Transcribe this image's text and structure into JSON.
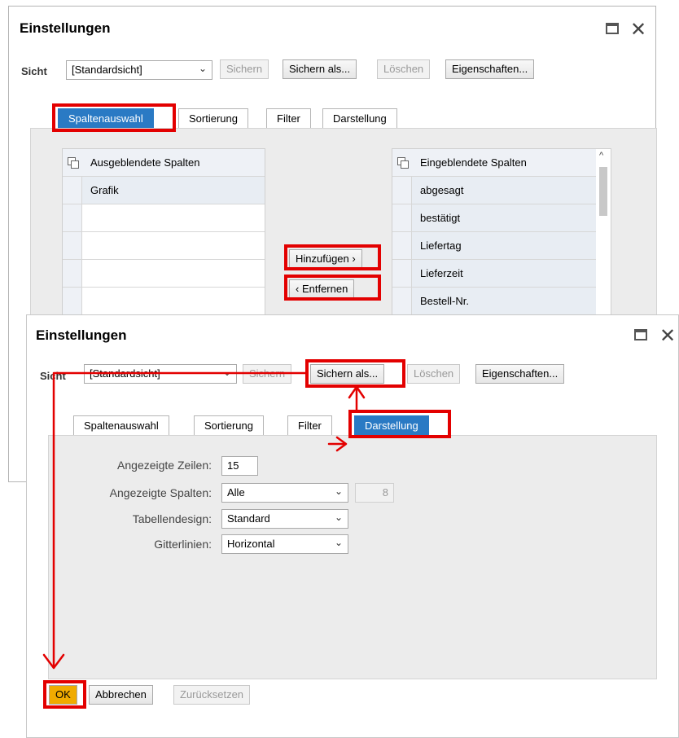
{
  "dialog1": {
    "title": "Einstellungen",
    "view_label": "Sicht",
    "view_value": "[Standardsicht]",
    "buttons": {
      "save": "Sichern",
      "save_as": "Sichern als...",
      "delete": "Löschen",
      "properties": "Eigenschaften..."
    },
    "tabs": [
      "Spaltenauswahl",
      "Sortierung",
      "Filter",
      "Darstellung"
    ],
    "hidden_columns": {
      "header": "Ausgeblendete Spalten",
      "rows": [
        "Grafik",
        "",
        "",
        "",
        ""
      ]
    },
    "shown_columns": {
      "header": "Eingeblendete Spalten",
      "rows": [
        "abgesagt",
        "bestätigt",
        "Liefertag",
        "Lieferzeit",
        "Bestell-Nr."
      ]
    },
    "add_button": "Hinzufügen",
    "remove_button": "Entfernen"
  },
  "dialog2": {
    "title": "Einstellungen",
    "view_label": "Sicht",
    "view_value": "[Standardsicht]",
    "buttons": {
      "save": "Sichern",
      "save_as": "Sichern als...",
      "delete": "Löschen",
      "properties": "Eigenschaften..."
    },
    "tabs": [
      "Spaltenauswahl",
      "Sortierung",
      "Filter",
      "Darstellung"
    ],
    "form": {
      "rows_label": "Angezeigte Zeilen:",
      "rows_value": "15",
      "cols_label": "Angezeigte Spalten:",
      "cols_value": "Alle",
      "cols_count": "8",
      "design_label": "Tabellendesign:",
      "design_value": "Standard",
      "grid_label": "Gitterlinien:",
      "grid_value": "Horizontal"
    },
    "footer": {
      "ok": "OK",
      "cancel": "Abbrechen",
      "reset": "Zurücksetzen"
    }
  },
  "colors": {
    "active_tab": "#2a7ac4",
    "highlight": "#e30000",
    "ok_button": "#f0ab00"
  },
  "icons": [
    "maximize-icon",
    "close-icon",
    "chevron-down-icon",
    "copy-icon",
    "chevron-right-icon",
    "chevron-left-icon"
  ]
}
